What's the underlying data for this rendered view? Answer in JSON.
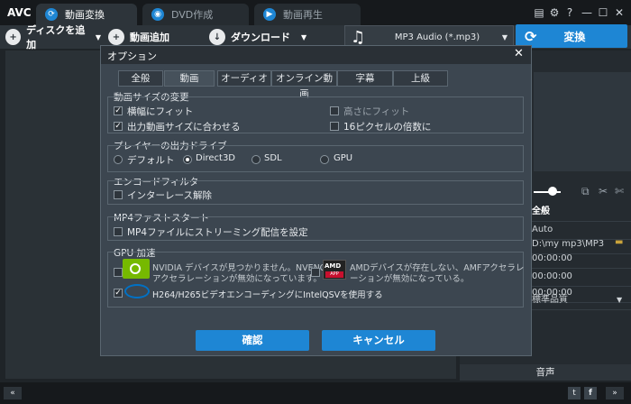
{
  "app": {
    "logo": "AVC"
  },
  "tabs": [
    {
      "label": "動画変換"
    },
    {
      "label": "DVD作成"
    },
    {
      "label": "動画再生"
    }
  ],
  "toolbar": {
    "add_disc": "ディスクを追加",
    "add_video": "動画追加",
    "download": "ダウンロード",
    "format": "MP3 Audio (*.mp3)",
    "convert": "変換"
  },
  "right_panel": {
    "all": "全般",
    "auto": "Auto",
    "path": "D:\\my mp3\\MP3",
    "time1": "00:00:00",
    "time2": "00:00:00",
    "time3": "00:00:00",
    "quality": "標準品質",
    "audio": "音声"
  },
  "dialog": {
    "title": "オプション",
    "tabs": [
      "全般",
      "動画",
      "オーディオ",
      "オンライン動画",
      "字幕",
      "上級"
    ],
    "active_tab": "動画",
    "size_group": {
      "title": "動画サイズの変更",
      "fit_width": "横幅にフィット",
      "fit_height": "高さにフィット",
      "match_output": "出力動画サイズに合わせる",
      "multiple16": "16ピクセルの倍数に"
    },
    "driver_group": {
      "title": "プレイヤーの出力ドライブ",
      "default": "デフォルト",
      "direct3d": "Direct3D",
      "sdl": "SDL",
      "gpu": "GPU"
    },
    "encoder_group": {
      "title": "エンコードフィルタ",
      "deinterlace": "インターレース解除"
    },
    "mp4_group": {
      "title": "MP4ファストスタート",
      "streaming": "MP4ファイルにストリーミング配信を設定"
    },
    "gpu_group": {
      "title": "GPU 加速",
      "nvidia_line1": "NVIDIA デバイスが見つかりません。NVENC",
      "nvidia_line2": "アクセラレーションが無効になっています。",
      "amd_line1": "AMDデバイスが存在しない、AMFアクセラレ",
      "amd_line2": "ーションが無効になっている。",
      "intel": "H264/H265ビデオエンコーディングにIntelQSVを使用する",
      "amd_badge": "AMD",
      "amd_app": "APP"
    },
    "ok": "確認",
    "cancel": "キャンセル"
  },
  "colors": {
    "accent": "#1e86d4",
    "nvidia": "#76b900",
    "amd": "#c8102e",
    "intel": "#0071c5"
  }
}
